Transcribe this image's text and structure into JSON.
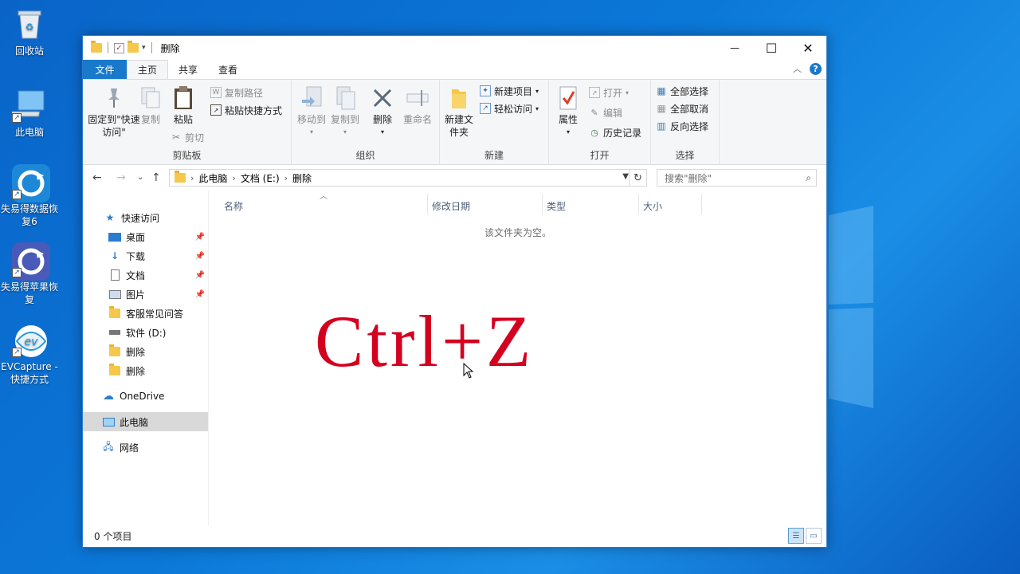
{
  "desktop": {
    "icons": [
      {
        "label": "回收站"
      },
      {
        "label": "此电脑"
      },
      {
        "label": "失易得数据恢复6"
      },
      {
        "label": "失易得苹果恢复"
      },
      {
        "label": "EVCapture - 快捷方式"
      }
    ]
  },
  "window": {
    "title": "删除",
    "controls": {
      "minimize": "—",
      "maximize": "☐",
      "close": "✕"
    }
  },
  "tabs": [
    {
      "label": "文件"
    },
    {
      "label": "主页"
    },
    {
      "label": "共享"
    },
    {
      "label": "查看"
    }
  ],
  "ribbon": {
    "clipboard": {
      "label": "剪贴板",
      "pin_quick": "固定到\"快速访问\"",
      "copy": "复制",
      "paste": "粘贴",
      "copy_path": "复制路径",
      "paste_shortcut": "粘贴快捷方式",
      "cut": "剪切"
    },
    "organize": {
      "label": "组织",
      "move_to": "移动到",
      "copy_to": "复制到",
      "delete": "删除",
      "rename": "重命名"
    },
    "new": {
      "label": "新建",
      "new_folder": "新建文件夹",
      "new_item": "新建项目",
      "easy_access": "轻松访问"
    },
    "open": {
      "label": "打开",
      "properties": "属性",
      "open": "打开",
      "edit": "编辑",
      "history": "历史记录"
    },
    "select": {
      "label": "选择",
      "select_all": "全部选择",
      "select_none": "全部取消",
      "invert": "反向选择"
    }
  },
  "address": {
    "crumbs": [
      "此电脑",
      "文档 (E:)",
      "删除"
    ],
    "search_placeholder": "搜索\"删除\""
  },
  "nav": {
    "quick_access": "快速访问",
    "items": [
      {
        "label": "桌面"
      },
      {
        "label": "下载"
      },
      {
        "label": "文档"
      },
      {
        "label": "图片"
      },
      {
        "label": "客服常见问答"
      },
      {
        "label": "软件 (D:)"
      },
      {
        "label": "删除"
      },
      {
        "label": "删除"
      }
    ],
    "onedrive": "OneDrive",
    "this_pc": "此电脑",
    "network": "网络"
  },
  "columns": {
    "name": "名称",
    "modified": "修改日期",
    "type": "类型",
    "size": "大小"
  },
  "content": {
    "empty_message": "该文件夹为空。",
    "overlay_text": "Ctrl+Z"
  },
  "status": {
    "item_count": "0 个项目"
  },
  "colors": {
    "accent": "#1979ca",
    "overlay_text": "#d40020"
  }
}
